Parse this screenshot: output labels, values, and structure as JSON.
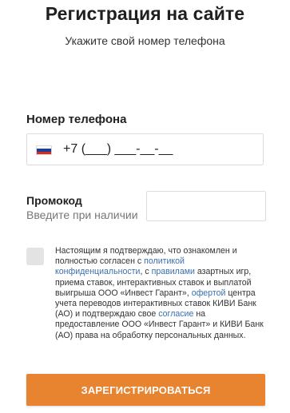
{
  "header": {
    "title": "Регистрация на сайте",
    "subtitle": "Укажите свой номер телефона"
  },
  "phone": {
    "label": "Номер телефона",
    "country_icon": "russia-flag-icon",
    "value": "+7 (___) ___-__-__"
  },
  "promo": {
    "label": "Промокод",
    "hint": "Введите при наличии",
    "value": ""
  },
  "consent": {
    "checked": false,
    "text_1": "Настоящим я подтверждаю, что ознакомлен и полностью согласен с ",
    "link_policy": "политикой конфиденциальности",
    "text_2": ", с ",
    "link_rules": "правилами",
    "text_3": " азартных игр, приема ставок, интерактивных ставок и выплатой выигрыша ООО «Инвест Гарант», ",
    "link_offer": "офертой",
    "text_4": " центра учета переводов интерактивных ставок КИВИ Банк (АО) и подтверждаю свое ",
    "link_agreement": "согласие",
    "text_5": " на предоставление ООО «Инвест Гарант» и КИВИ Банк (АО) права на обработку персональных данных."
  },
  "submit": {
    "label": "Зарегистрироваться"
  },
  "colors": {
    "accent": "#e8832f",
    "link": "#3a6fb0",
    "checkbox_bg": "#e3e3e3"
  }
}
